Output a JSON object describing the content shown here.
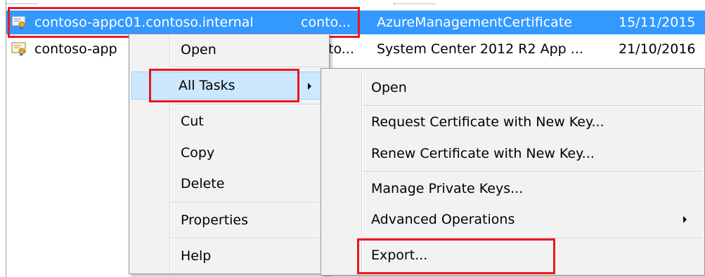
{
  "list": {
    "rows": [
      {
        "name": "contoso-appc01.contoso.internal",
        "issuer": "conto...",
        "purpose": "AzureManagementCertificate",
        "date": "15/11/2015"
      },
      {
        "name": "contoso-app",
        "issuer": "to...",
        "purpose": "System Center 2012 R2 App ...",
        "date": "21/10/2016"
      }
    ]
  },
  "context_menu": {
    "items": [
      "Open",
      "All Tasks",
      "Cut",
      "Copy",
      "Delete",
      "Properties",
      "Help"
    ]
  },
  "submenu": {
    "items": [
      "Open",
      "Request Certificate with New Key...",
      "Renew Certificate with New Key...",
      "Manage Private Keys...",
      "Advanced Operations",
      "Export..."
    ]
  },
  "colors": {
    "selection": "#3399ff",
    "menu_highlight": "#cce8ff",
    "annotation": "#e8171f"
  },
  "icons": {
    "certificate": "certificate-icon",
    "submenu_arrow": "submenu-arrow-icon"
  }
}
